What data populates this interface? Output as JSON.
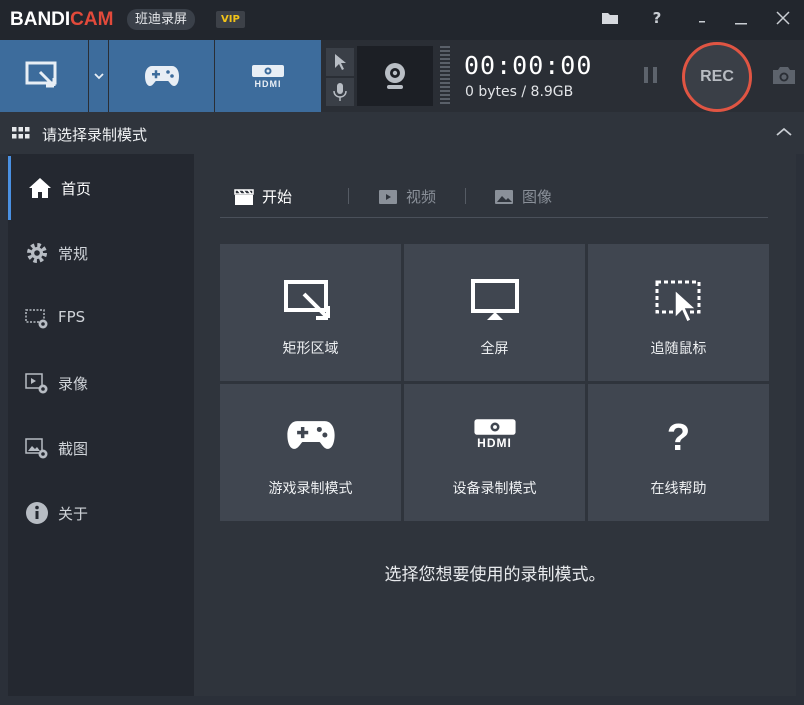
{
  "app": {
    "logo_left": "BANDI",
    "logo_right": "CAM",
    "product_name": "班迪录屏",
    "vip_label": "VIP"
  },
  "window_controls": [
    "folder-icon",
    "help-icon",
    "minimize-small-icon",
    "minimize-icon",
    "close-icon"
  ],
  "toolbar": {
    "timer": "00:00:00",
    "size": "0 bytes / 8.9GB",
    "rec_label": "REC",
    "hdmi_label": "HDMI"
  },
  "section": {
    "title": "请选择录制模式"
  },
  "sidebar": {
    "items": [
      {
        "label": "首页",
        "icon": "home-icon"
      },
      {
        "label": "常规",
        "icon": "gear-icon"
      },
      {
        "label": "FPS",
        "icon": "fps-icon"
      },
      {
        "label": "录像",
        "icon": "video-settings-icon"
      },
      {
        "label": "截图",
        "icon": "image-settings-icon"
      },
      {
        "label": "关于",
        "icon": "info-icon"
      }
    ]
  },
  "tabs": [
    {
      "label": "开始",
      "icon": "clapper-icon"
    },
    {
      "label": "视频",
      "icon": "play-icon"
    },
    {
      "label": "图像",
      "icon": "picture-icon"
    }
  ],
  "tiles": [
    {
      "label": "矩形区域",
      "icon": "rectangle-area-icon"
    },
    {
      "label": "全屏",
      "icon": "monitor-icon"
    },
    {
      "label": "追随鼠标",
      "icon": "cursor-follow-icon"
    },
    {
      "label": "游戏录制模式",
      "icon": "gamepad-icon"
    },
    {
      "label": "设备录制模式",
      "icon": "hdmi-icon",
      "sub_label": "HDMI"
    },
    {
      "label": "在线帮助",
      "icon": "question-icon",
      "glyph": "?"
    }
  ],
  "hint": "选择您想要使用的录制模式。",
  "colors": {
    "accent": "#3d6c9c",
    "rec_ring": "#e05543",
    "active_bar": "#4a90e2"
  }
}
